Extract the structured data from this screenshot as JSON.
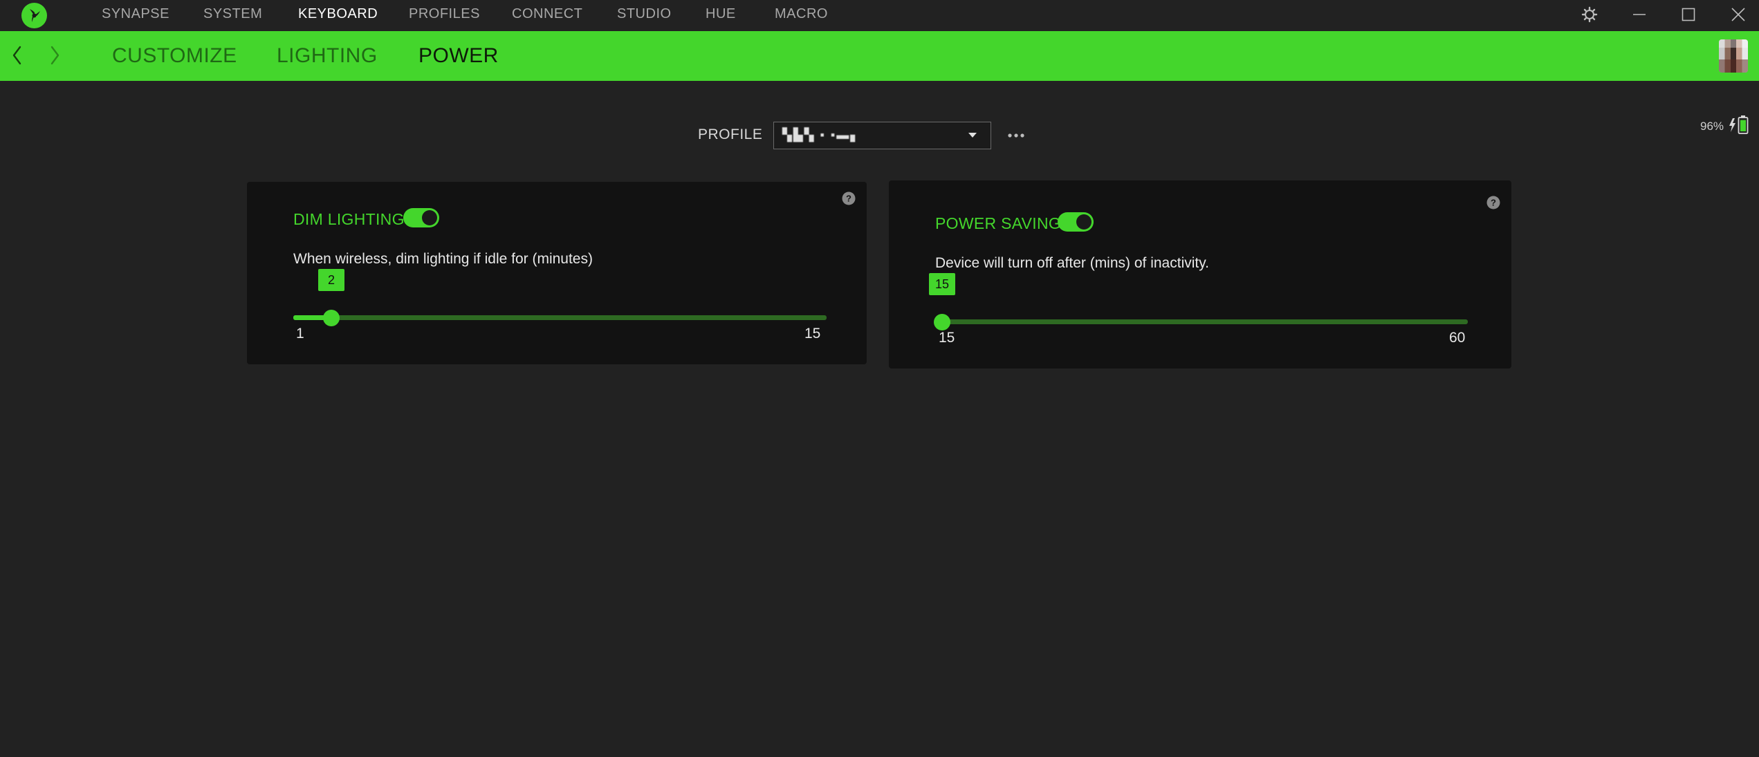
{
  "colors": {
    "accent": "#44d62c",
    "background": "#222222",
    "card": "#121212",
    "track_inactive": "#2e6a22"
  },
  "app": {
    "logo_icon": "razer-logo-icon"
  },
  "top_nav": {
    "items": [
      {
        "label": "SYNAPSE",
        "active": false
      },
      {
        "label": "SYSTEM",
        "active": false
      },
      {
        "label": "KEYBOARD",
        "active": true
      },
      {
        "label": "PROFILES",
        "active": false
      },
      {
        "label": "CONNECT",
        "active": false
      },
      {
        "label": "STUDIO",
        "active": false
      },
      {
        "label": "HUE",
        "active": false
      },
      {
        "label": "MACRO",
        "active": false
      }
    ]
  },
  "window_controls": [
    "settings-gear-icon",
    "minimize-icon",
    "maximize-icon",
    "close-icon"
  ],
  "sub_nav": {
    "tabs": [
      {
        "label": "CUSTOMIZE",
        "active": false
      },
      {
        "label": "LIGHTING",
        "active": false
      },
      {
        "label": "POWER",
        "active": true
      }
    ]
  },
  "battery": {
    "percent_label": "96%",
    "level": 0.96,
    "charging": true
  },
  "profile": {
    "label": "PROFILE",
    "selected_value": "▚▙▚ ▪ ▪▬▖"
  },
  "dim_lighting": {
    "title": "DIM LIGHTING",
    "enabled": true,
    "description": "When wireless, dim lighting if idle for (minutes)",
    "slider": {
      "min": 1,
      "max": 15,
      "value": 2,
      "min_label": "1",
      "max_label": "15",
      "value_label": "2"
    }
  },
  "power_saving": {
    "title": "POWER SAVING",
    "enabled": true,
    "description": "Device will turn off after (mins) of inactivity.",
    "slider": {
      "min": 15,
      "max": 60,
      "value": 15,
      "min_label": "15",
      "max_label": "60",
      "value_label": "15"
    }
  }
}
